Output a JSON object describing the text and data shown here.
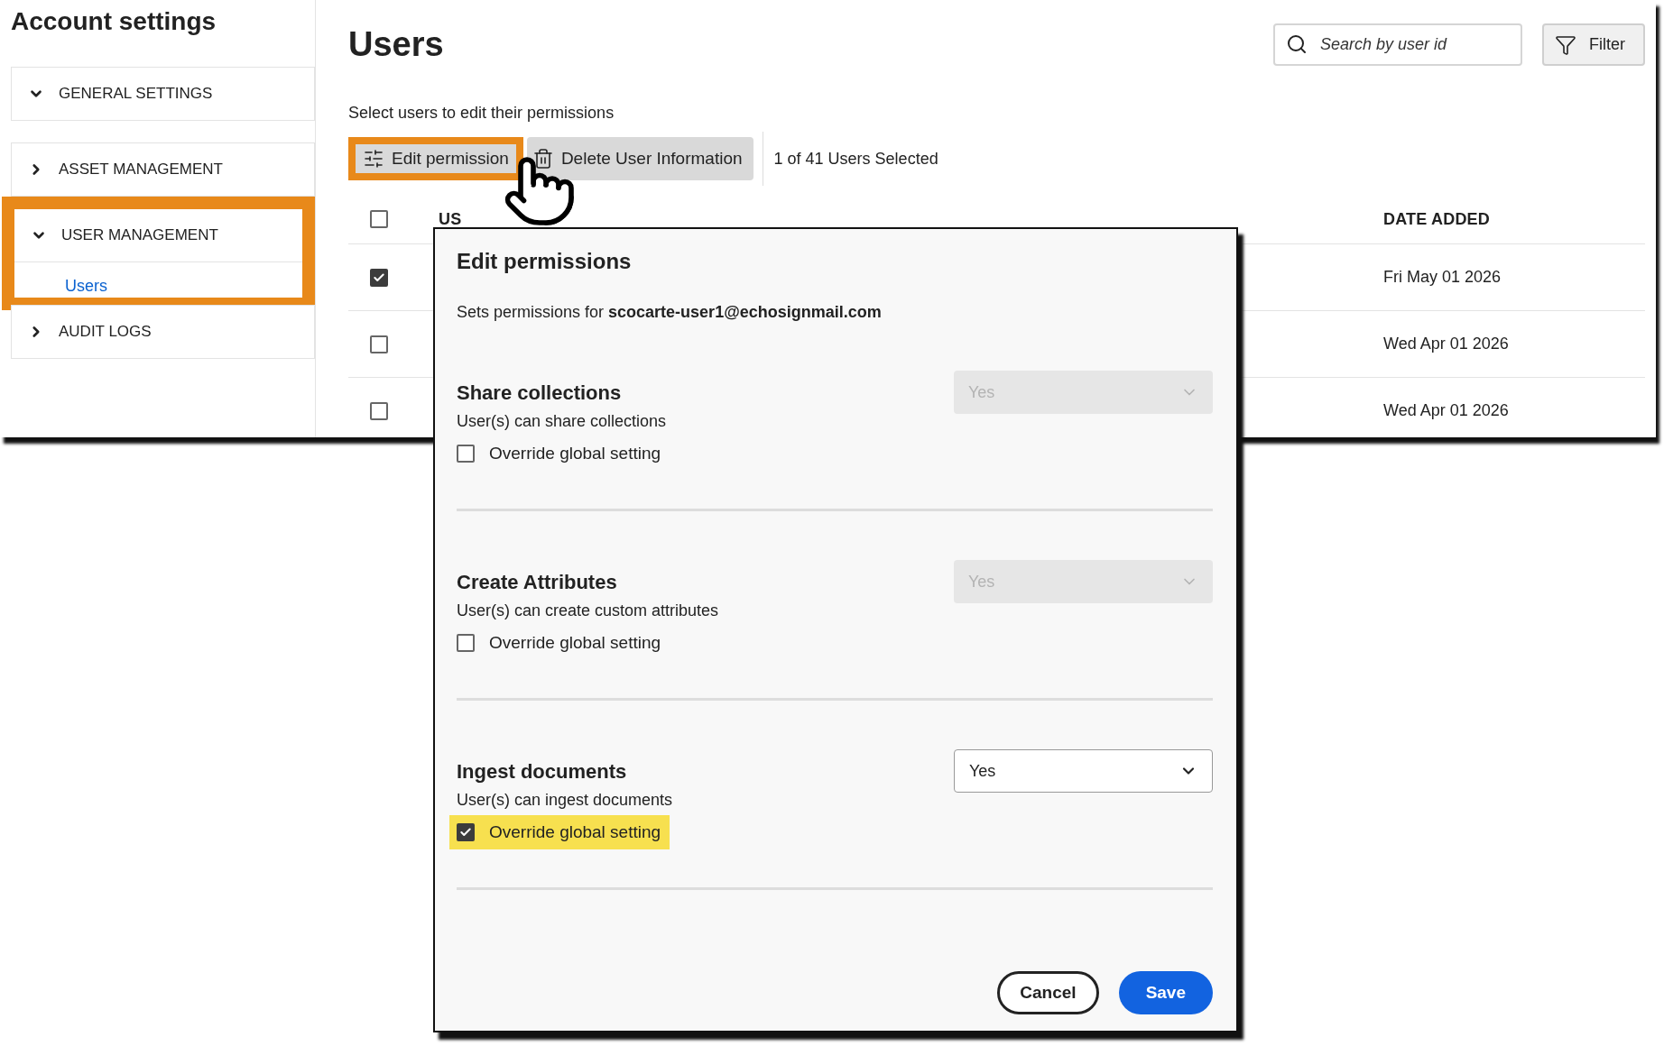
{
  "sidebar": {
    "title": "Account settings",
    "sections": [
      {
        "label": "GENERAL SETTINGS",
        "expanded": true,
        "highlighted": false
      },
      {
        "label": "ASSET MANAGEMENT",
        "expanded": false,
        "highlighted": false
      },
      {
        "label": "USER MANAGEMENT",
        "expanded": true,
        "highlighted": true,
        "children": [
          {
            "label": "Users",
            "selected": true
          }
        ]
      },
      {
        "label": "AUDIT LOGS",
        "expanded": false,
        "highlighted": false
      }
    ]
  },
  "main": {
    "title": "Users",
    "search": {
      "placeholder": "Search by user id"
    },
    "filter_button": "Filter",
    "instruction": "Select users to edit their permissions",
    "toolbar": {
      "edit_button": {
        "label": "Edit permission",
        "highlighted": true
      },
      "delete_button": {
        "label": "Delete User Information"
      },
      "selection_count": "1 of 41 Users Selected"
    },
    "table": {
      "columns": [
        "US",
        "DATE ADDED"
      ],
      "header_checked": false,
      "rows": [
        {
          "checked": true,
          "date": "Fri May 01 2026"
        },
        {
          "checked": false,
          "date": "Wed Apr 01 2026"
        },
        {
          "checked": false,
          "date": "Wed Apr 01 2026"
        }
      ]
    }
  },
  "dialog": {
    "title": "Edit permissions",
    "subtitle": "Sets permissions for **scocarte-user1@echosignmail.com**",
    "sections": [
      {
        "title": "Share collections",
        "description": "User(s) can share collections",
        "dropdown": {
          "value": "Yes",
          "disabled": true
        },
        "override": {
          "label": "Override global setting",
          "checked": false,
          "highlighted": false
        }
      },
      {
        "title": "Create Attributes",
        "description": "User(s) can create custom attributes",
        "dropdown": {
          "value": "Yes",
          "disabled": true
        },
        "override": {
          "label": "Override global setting",
          "checked": false,
          "highlighted": false
        }
      },
      {
        "title": "Ingest documents",
        "description": "User(s) can ingest documents",
        "dropdown": {
          "value": "Yes",
          "disabled": false
        },
        "override": {
          "label": "Override global setting",
          "checked": true,
          "highlighted": true
        }
      }
    ],
    "cancel_button": "Cancel",
    "save_button": "Save"
  }
}
